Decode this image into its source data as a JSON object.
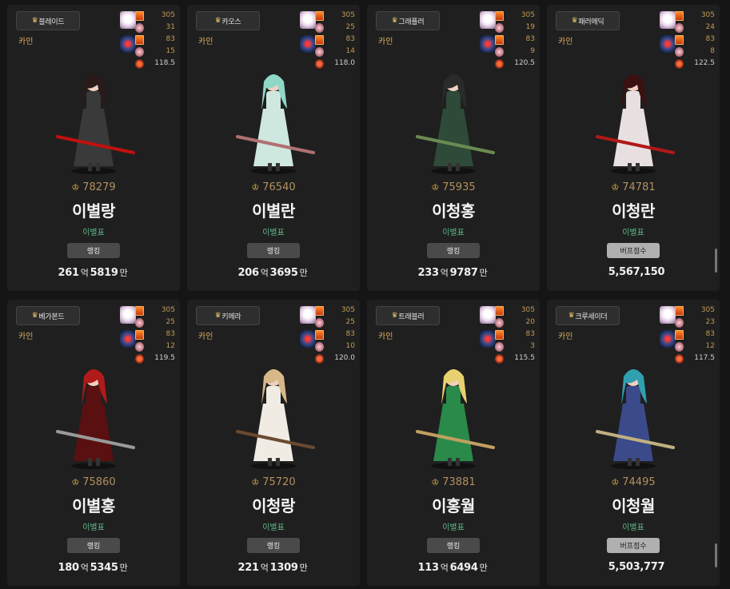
{
  "cards": [
    {
      "job": "블레이드",
      "server": "카인",
      "stats": [
        "305",
        "31",
        "83",
        "15",
        "118.5"
      ],
      "score": "78279",
      "name": "이별랑",
      "guild": "이별표",
      "button": "랭킹",
      "value_a": "261",
      "value_b": "5819",
      "unit_a": "억",
      "unit_b": "만",
      "value": "",
      "hair": "#2a1a1a",
      "dress": "#3a3a3a",
      "weapon": "#c01010"
    },
    {
      "job": "카오스",
      "server": "카인",
      "stats": [
        "305",
        "25",
        "83",
        "14",
        "118.0"
      ],
      "score": "76540",
      "name": "이별란",
      "guild": "이별표",
      "button": "랭킹",
      "value_a": "206",
      "value_b": "3695",
      "unit_a": "억",
      "unit_b": "만",
      "value": "",
      "hair": "#8fd8c8",
      "dress": "#cfe8df",
      "weapon": "#b07070"
    },
    {
      "job": "그래플러",
      "server": "카인",
      "stats": [
        "305",
        "19",
        "83",
        "9",
        "120.5"
      ],
      "score": "75935",
      "name": "이청홍",
      "guild": "이별표",
      "button": "랭킹",
      "value_a": "233",
      "value_b": "9787",
      "unit_a": "억",
      "unit_b": "만",
      "value": "",
      "hair": "#2a2a2a",
      "dress": "#2e4a38",
      "weapon": "#6a8a50"
    },
    {
      "job": "패러메딕",
      "server": "카인",
      "stats": [
        "305",
        "24",
        "83",
        "8",
        "122.5"
      ],
      "score": "74781",
      "name": "이청란",
      "guild": "이별표",
      "button": "버프점수",
      "value_a": "",
      "value_b": "",
      "unit_a": "",
      "unit_b": "",
      "value": "5,567,150",
      "hair": "#3a1010",
      "dress": "#e8e0e0",
      "weapon": "#b01818"
    },
    {
      "job": "베가본드",
      "server": "카인",
      "stats": [
        "305",
        "25",
        "83",
        "12",
        "119.5"
      ],
      "score": "75860",
      "name": "이별홍",
      "guild": "이별표",
      "button": "랭킹",
      "value_a": "180",
      "value_b": "5345",
      "unit_a": "억",
      "unit_b": "만",
      "value": "",
      "hair": "#b01a1a",
      "dress": "#5a1010",
      "weapon": "#9a9a9a"
    },
    {
      "job": "키메라",
      "server": "카인",
      "stats": [
        "305",
        "25",
        "83",
        "10",
        "120.0"
      ],
      "score": "75720",
      "name": "이청랑",
      "guild": "이별표",
      "button": "랭킹",
      "value_a": "221",
      "value_b": "1309",
      "unit_a": "억",
      "unit_b": "만",
      "value": "",
      "hair": "#d8b888",
      "dress": "#f0ece4",
      "weapon": "#6a4a30"
    },
    {
      "job": "트래블러",
      "server": "카인",
      "stats": [
        "305",
        "20",
        "83",
        "3",
        "115.5"
      ],
      "score": "73881",
      "name": "이홍월",
      "guild": "이별표",
      "button": "랭킹",
      "value_a": "113",
      "value_b": "6494",
      "unit_a": "억",
      "unit_b": "만",
      "value": "",
      "hair": "#e8d070",
      "dress": "#2a8a4a",
      "weapon": "#c0a060"
    },
    {
      "job": "크루세이더",
      "server": "카인",
      "stats": [
        "305",
        "23",
        "83",
        "12",
        "117.5"
      ],
      "score": "74495",
      "name": "이청월",
      "guild": "이별표",
      "button": "버프점수",
      "value_a": "",
      "value_b": "",
      "unit_a": "",
      "unit_b": "",
      "value": "5,503,777",
      "hair": "#30a0b0",
      "dress": "#3a4a8a",
      "weapon": "#c0b080"
    }
  ],
  "icons": {
    "job": "star-icon",
    "medal": "medal-icon"
  }
}
